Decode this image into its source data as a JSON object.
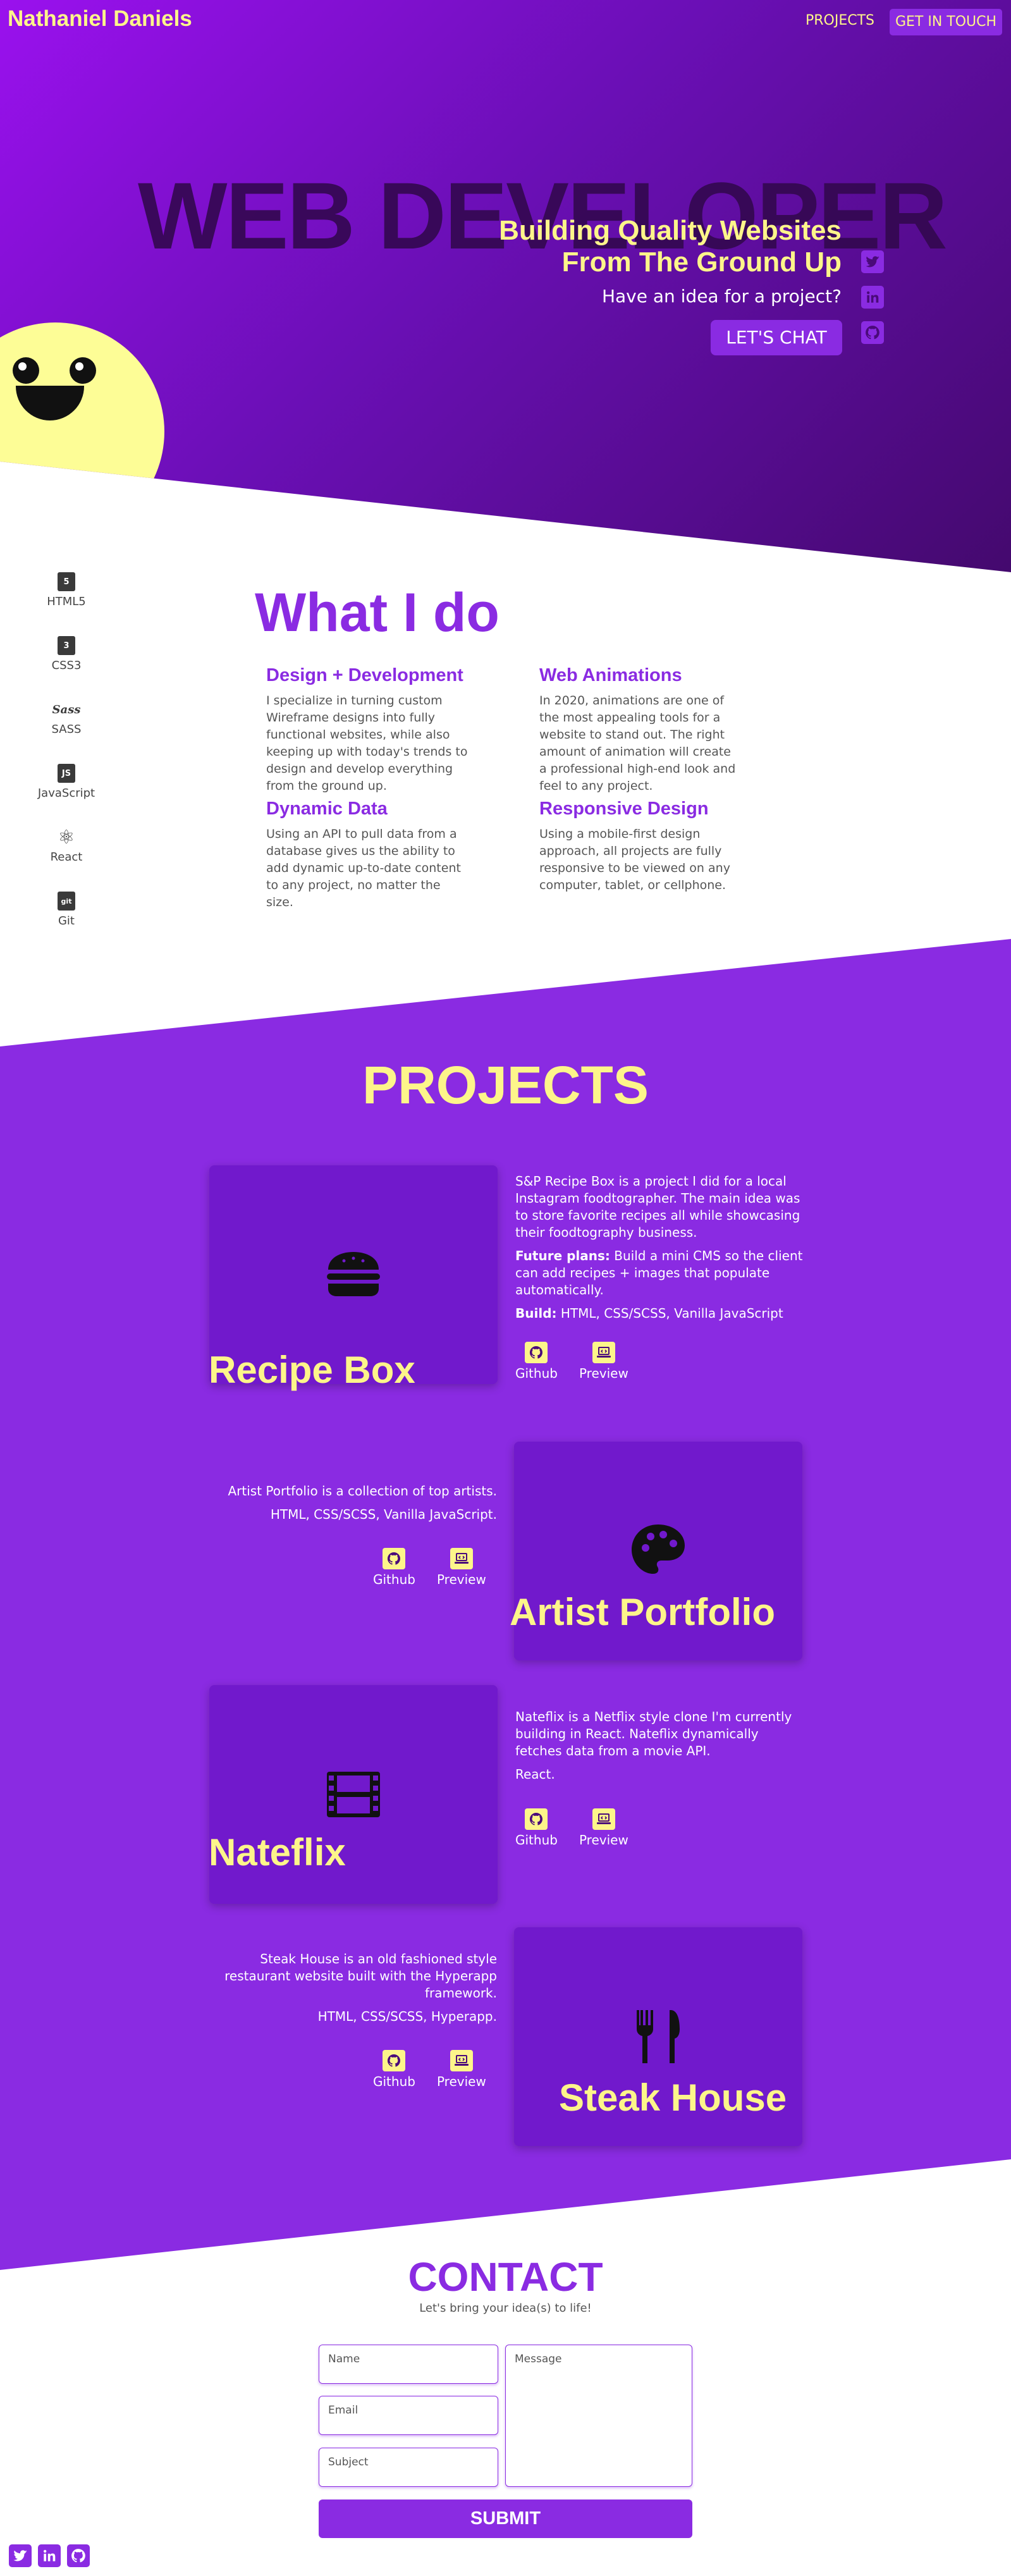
{
  "header": {
    "brand": "Nathaniel Daniels",
    "nav": {
      "projects": "PROJECTS",
      "get_in_touch": "GET IN TOUCH"
    }
  },
  "hero": {
    "background_word": "WEB DEVELOPER",
    "tagline_line1": "Building Quality Websites",
    "tagline_line2": "From The Ground Up",
    "idea_text": "Have an idea for a project?",
    "cta": "LET'S CHAT",
    "social_icons": [
      "twitter-icon",
      "linkedin-icon",
      "github-icon"
    ]
  },
  "what_i_do": {
    "title": "What I do",
    "skills": [
      {
        "label": "HTML5",
        "icon": "html5-icon",
        "glyph": "5"
      },
      {
        "label": "CSS3",
        "icon": "css3-icon",
        "glyph": "3"
      },
      {
        "label": "SASS",
        "icon": "sass-icon",
        "glyph": "Sass"
      },
      {
        "label": "JavaScript",
        "icon": "javascript-icon",
        "glyph": "JS"
      },
      {
        "label": "React",
        "icon": "react-icon",
        "glyph": "⚛"
      },
      {
        "label": "Git",
        "icon": "git-icon",
        "glyph": "git"
      }
    ],
    "services": [
      {
        "title": "Design + Development",
        "text": "I specialize in turning custom Wireframe designs into fully functional websites, while also keeping up with today's trends to design and develop everything from the ground up."
      },
      {
        "title": "Web Animations",
        "text": "In 2020, animations are one of the most appealing tools for a website to stand out. The right amount of animation will create a professional high-end look and feel to any project."
      },
      {
        "title": "Dynamic Data",
        "text": "Using an API to pull data from a database gives us the ability to add dynamic up-to-date content to any project, no matter the size."
      },
      {
        "title": "Responsive Design",
        "text": "Using a mobile-first design approach, all projects are fully responsive to be viewed on any computer, tablet, or cellphone."
      }
    ]
  },
  "projects": {
    "title": "PROJECTS",
    "items": [
      {
        "name": "Recipe Box",
        "icon": "hamburger-icon",
        "description": "S&P Recipe Box is a project I did for a local Instagram foodtographer. The main idea was to store favorite recipes all while showcasing their foodtography business.",
        "future_label": "Future plans:",
        "future_text": "Build a mini CMS so the client can add recipes + images that populate automatically.",
        "build_label": "Build:",
        "build_text": "HTML, CSS/SCSS, Vanilla JavaScript",
        "github": "Github",
        "preview": "Preview"
      },
      {
        "name": "Artist Portfolio",
        "icon": "palette-icon",
        "description": "Artist Portfolio is a collection of top artists.",
        "build_text": "HTML, CSS/SCSS, Vanilla JavaScript.",
        "github": "Github",
        "preview": "Preview"
      },
      {
        "name": "Nateflix",
        "icon": "film-icon",
        "description": "Nateflix is a Netflix style clone I'm currently building in React. Nateflix dynamically fetches data from a movie API.",
        "build_text": "React.",
        "github": "Github",
        "preview": "Preview"
      },
      {
        "name": "Steak House",
        "icon": "utensils-icon",
        "description": "Steak House is an old fashioned style restaurant website built with the Hyperapp framework.",
        "build_text": "HTML, CSS/SCSS, Hyperapp.",
        "github": "Github",
        "preview": "Preview"
      }
    ]
  },
  "contact": {
    "title": "CONTACT",
    "subtitle": "Let's bring your idea(s) to life!",
    "name_placeholder": "Name",
    "email_placeholder": "Email",
    "subject_placeholder": "Subject",
    "message_placeholder": "Message",
    "submit": "SUBMIT"
  },
  "colors": {
    "purple": "#8a2be2",
    "yellow": "#fdf58a",
    "dark_purple": "#44096e",
    "card_purple": "#7119cc"
  }
}
